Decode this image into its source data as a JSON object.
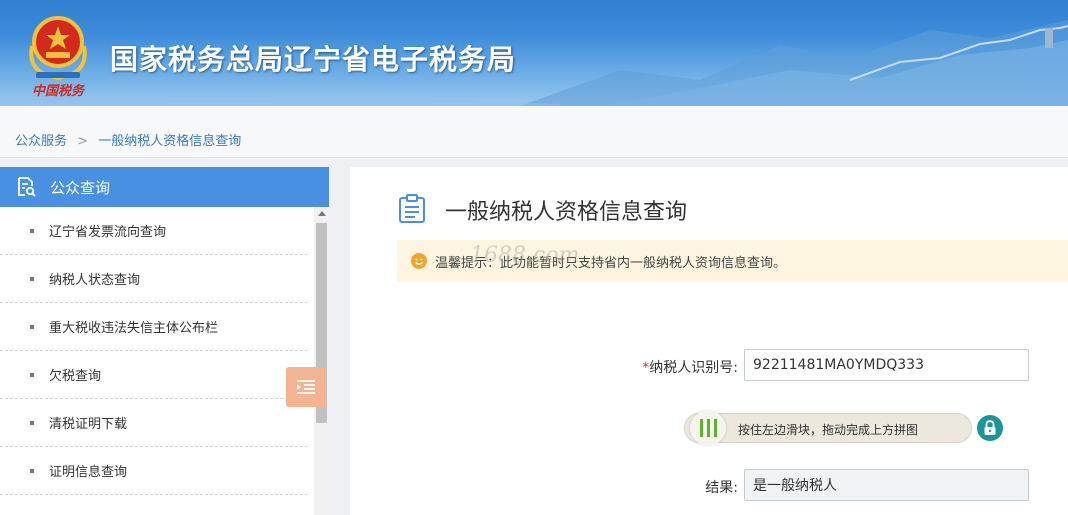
{
  "header": {
    "title": "国家税务总局辽宁省电子税务局",
    "logo_text": "中国税务"
  },
  "breadcrumb": {
    "items": [
      "公众服务",
      "一般纳税人资格信息查询"
    ],
    "separator": ">"
  },
  "sidebar": {
    "title": "公众查询",
    "items": [
      {
        "label": "辽宁省发票流向查询"
      },
      {
        "label": "纳税人状态查询"
      },
      {
        "label": "重大税收违法失信主体公布栏"
      },
      {
        "label": "欠税查询"
      },
      {
        "label": "清税证明下载"
      },
      {
        "label": "证明信息查询"
      }
    ]
  },
  "main": {
    "title": "一般纳税人资格信息查询",
    "notice": "温馨提示：此功能暂时只支持省内一般纳税人资询信息查询。",
    "watermark": "1688.com",
    "form": {
      "required_mark": "*",
      "taxpayer_id_label": "纳税人识别号:",
      "taxpayer_id_value": "92211481MA0YMDQ333",
      "slider_text": "按住左边滑块，拖动完成上方拼图",
      "result_label": "结果:",
      "result_value": "是一般纳税人"
    }
  },
  "colors": {
    "accent": "#4a90e2",
    "notice_bg": "#fdf5e0",
    "slider_bar": "#5db32f",
    "lock": "#1a9696",
    "collapse_btn": "#f4b391"
  }
}
